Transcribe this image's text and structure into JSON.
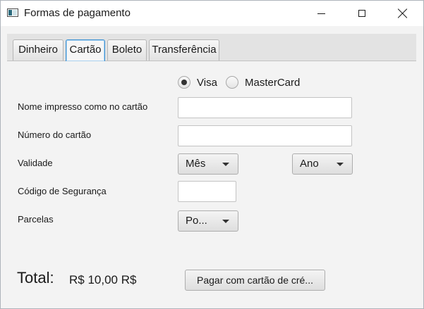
{
  "window": {
    "title": "Formas de pagamento"
  },
  "tabs": [
    {
      "label": "Dinheiro",
      "selected": false
    },
    {
      "label": "Cartão",
      "selected": true
    },
    {
      "label": "Boleto",
      "selected": false
    },
    {
      "label": "Transferência",
      "selected": false
    }
  ],
  "card_brand": {
    "options": [
      {
        "label": "Visa",
        "selected": true
      },
      {
        "label": "MasterCard",
        "selected": false
      }
    ]
  },
  "form": {
    "name_label": "Nome impresso como no cartão",
    "name_value": "",
    "number_label": "Número do cartão",
    "number_value": "",
    "expiry_label": "Validade",
    "month_value": "Mês",
    "year_value": "Ano",
    "cvv_label": "Código de Segurança",
    "cvv_value": "",
    "installments_label": "Parcelas",
    "installments_value": "Po..."
  },
  "footer": {
    "total_label": "Total:",
    "total_value": "R$ 10,00 R$",
    "pay_button_label": "Pagar com cartão de cré..."
  },
  "colors": {
    "window_background": "#f3f3f3",
    "selected_tab_border": "#3f92d2"
  }
}
